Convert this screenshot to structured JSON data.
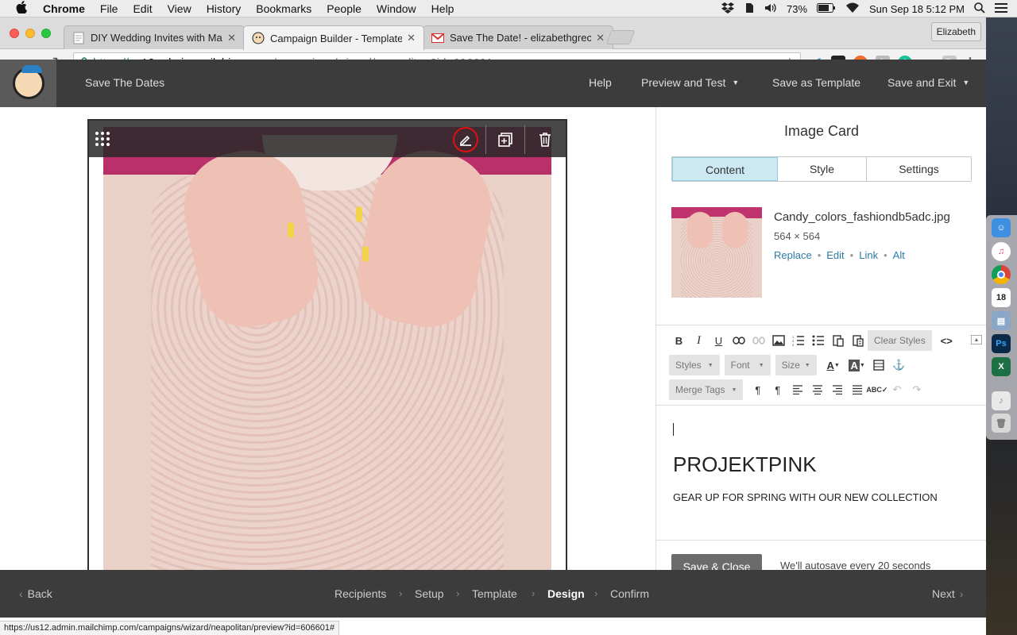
{
  "macbar": {
    "menus": [
      "Chrome",
      "File",
      "Edit",
      "View",
      "History",
      "Bookmarks",
      "People",
      "Window",
      "Help"
    ],
    "battery": "73%",
    "datetime": "Sun Sep 18  5:12 PM"
  },
  "browser": {
    "tabs": [
      {
        "title": "DIY Wedding Invites with Mailc",
        "favicon": "doc-icon"
      },
      {
        "title": "Campaign Builder - Template D",
        "favicon": "mailchimp-icon"
      },
      {
        "title": "Save The Date! - elizabethgrec",
        "favicon": "gmail-icon"
      }
    ],
    "profile": "Elizabeth",
    "url": {
      "scheme": "https://",
      "host": "us12.admin.mailchimp.com",
      "path": "/campaigns/wizard/neapolitan?id=606601"
    },
    "status_url": "https://us12.admin.mailchimp.com/campaigns/wizard/neapolitan/preview?id=606601#"
  },
  "header": {
    "campaign_name": "Save The Dates",
    "help": "Help",
    "preview": "Preview and Test",
    "save_template": "Save as Template",
    "save_exit": "Save and Exit"
  },
  "panel": {
    "title": "Image Card",
    "tabs": [
      "Content",
      "Style",
      "Settings"
    ],
    "active_tab": "Content",
    "image": {
      "filename": "Candy_colors_fashiondb5adc.jpg",
      "dimensions": "564 × 564",
      "actions": [
        "Replace",
        "Edit",
        "Link",
        "Alt"
      ]
    },
    "toolbar": {
      "clear_styles": "Clear Styles",
      "styles": "Styles",
      "font": "Font",
      "size": "Size",
      "merge_tags": "Merge Tags"
    },
    "content": {
      "heading": "PROJEKTPINK",
      "subheading": "GEAR UP FOR SPRING WITH OUR NEW COLLECTION"
    },
    "save_close": "Save & Close",
    "autosave": "We'll autosave every 20 seconds"
  },
  "wizard": {
    "back": "Back",
    "steps": [
      "Recipients",
      "Setup",
      "Template",
      "Design",
      "Confirm"
    ],
    "current_step": "Design",
    "next": "Next"
  },
  "colors": {
    "header_bg": "#3c3c3c",
    "active_tab_bg": "#cbe8f3",
    "link": "#2c7aa8",
    "highlight_ring": "#dd1111"
  }
}
